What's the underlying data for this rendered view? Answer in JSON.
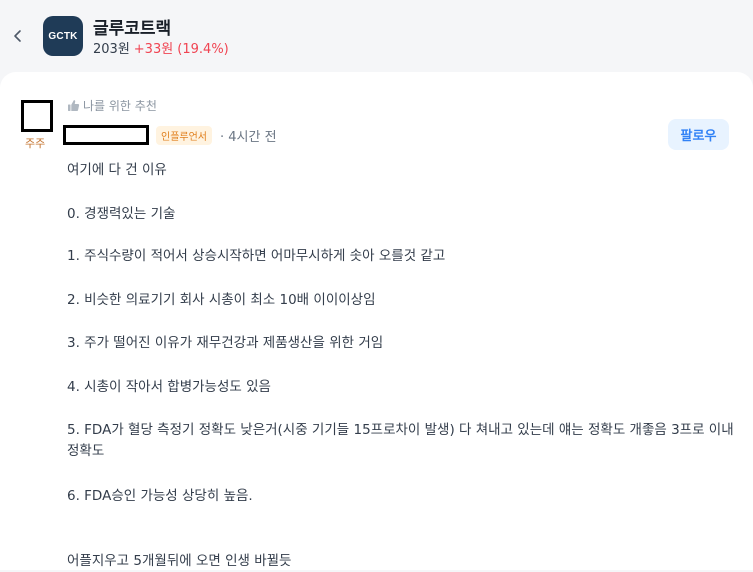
{
  "header": {
    "back_icon": "chevron-left-icon",
    "logo_text": "GCTK",
    "stock_name": "글루코트랙",
    "price": "203원",
    "change": "+33원 (19.4%)",
    "change_color": "#f04452",
    "logo_color": "#1f3b57"
  },
  "post": {
    "avatar_label": "주주",
    "recommend_text": "나를 위한 추천",
    "badge": "인플루언서",
    "time": "· 4시간 전",
    "follow_label": "팔로우",
    "lines": [
      "여기에 다 건 이유",
      "0. 경쟁력있는 기술",
      "1. 주식수량이 적어서 상승시작하면 어마무시하게 솟아 오를것 같고",
      "2. 비슷한 의료기기 회사 시총이 최소 10배 이이이상임",
      "3. 주가 떨어진 이유가 재무건강과 제품생산을 위한 거임",
      "4. 시총이 작아서 합병가능성도 있음",
      "5. FDA가 혈당 측정기 정확도 낮은거(시중 기기들 15프로차이 발생) 다 쳐내고 있는데 얘는 정확도 개좋음 3프로 이내 정확도",
      "6. FDA승인 가능성 상당히 높음.",
      "어플지우고 5개월뒤에 오면 인생 바뀔듯"
    ]
  }
}
